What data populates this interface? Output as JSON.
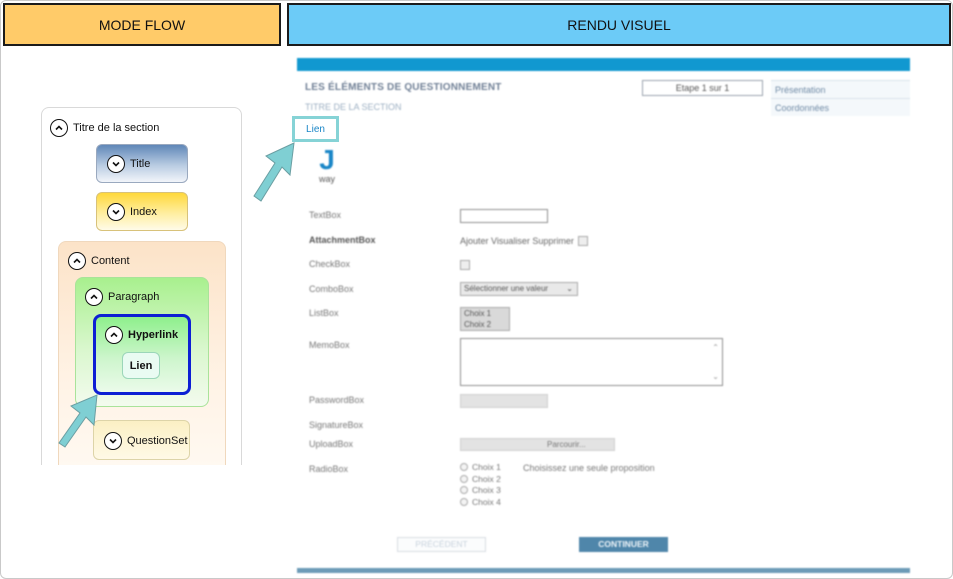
{
  "headers": {
    "left": "MODE FLOW",
    "right": "RENDU VISUEL"
  },
  "flow": {
    "section_title": "Titre de la section",
    "title_node": "Title",
    "index_node": "Index",
    "content_node": "Content",
    "paragraph_node": "Paragraph",
    "hyperlink_node": "Hyperlink",
    "hyperlink_button": "Lien",
    "questionset_node": "QuestionSet"
  },
  "render": {
    "heading": "LES ÉLÉMENTS DE QUESTIONNEMENT",
    "subheading": "TITRE DE LA SECTION",
    "step": "Etape 1 sur 1",
    "side_items": [
      "Présentation",
      "Coordonnées"
    ],
    "link_label": "Lien",
    "logo_letter": "J",
    "logo_word": "way",
    "fields": {
      "textbox": "TextBox",
      "attachmentbox": "AttachmentBox",
      "attachment_actions": "Ajouter Visualiser Supprimer",
      "checkbox": "CheckBox",
      "combobox": "ComboBox",
      "combo_value": "Sélectionner une valeur",
      "listbox": "ListBox",
      "list_items": [
        "Choix 1",
        "Choix 2"
      ],
      "memobox": "MemoBox",
      "passwordbox": "PasswordBox",
      "signaturebox": "SignatureBox",
      "uploadbox": "UploadBox",
      "upload_button": "Parcourir...",
      "radiobox": "RadioBox",
      "radio_options": [
        "Choix 1",
        "Choix 2",
        "Choix 3",
        "Choix 4"
      ],
      "radio_hint": "Choisissez une seule proposition"
    },
    "buttons": {
      "previous": "PRÉCÉDENT",
      "next": "CONTINUER"
    }
  },
  "colors": {
    "left_header": "#ffcb69",
    "right_header": "#6ccbf7",
    "arrow": "#7fcfd3",
    "hyperlink_border": "#0d1fd4",
    "render_topbar": "#1198d0",
    "continue_button": "#4f86aa"
  }
}
